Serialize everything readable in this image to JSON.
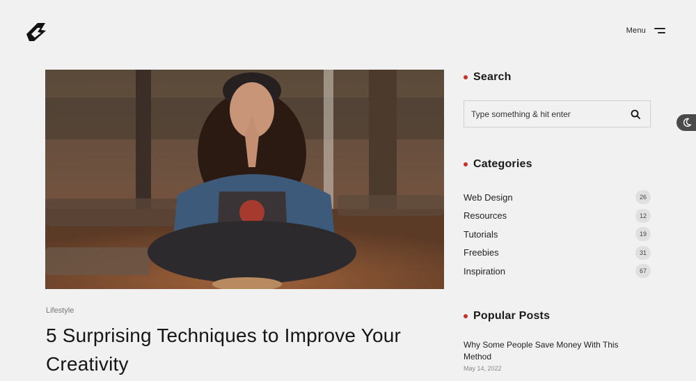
{
  "header": {
    "logo_icon": "brand-logo-icon",
    "menu_label": "Menu",
    "menu_icon": "hamburger-icon"
  },
  "post": {
    "category": "Lifestyle",
    "title": "5 Surprising Techniques to Improve Your Creativity",
    "image_icon": "featured-photo"
  },
  "sidebar": {
    "search": {
      "heading": "Search",
      "placeholder": "Type something & hit enter",
      "value": "",
      "icon": "search-icon"
    },
    "categories": {
      "heading": "Categories",
      "items": [
        {
          "name": "Web Design",
          "count": "26"
        },
        {
          "name": "Resources",
          "count": "12"
        },
        {
          "name": "Tutorials",
          "count": "19"
        },
        {
          "name": "Freebies",
          "count": "31"
        },
        {
          "name": "Inspiration",
          "count": "67"
        }
      ]
    },
    "popular": {
      "heading": "Popular Posts",
      "items": [
        {
          "title": "Why Some People Save Money With This Method",
          "date": "May 14, 2022"
        }
      ]
    }
  },
  "theme_toggle": {
    "icon": "moon-icon"
  },
  "colors": {
    "accent": "#c6312a",
    "background": "#f1f1f1",
    "text": "#1e1e1e"
  }
}
